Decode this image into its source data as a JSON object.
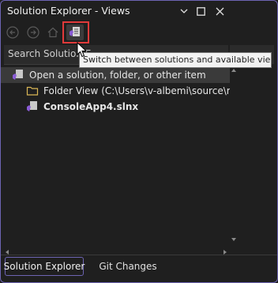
{
  "window": {
    "title": "Solution Explorer - Views",
    "controls": [
      "chevron-down-icon",
      "maximize-icon",
      "close-icon"
    ]
  },
  "toolbar": {
    "buttons": [
      "back-arrow-icon",
      "forward-arrow-icon",
      "home-icon",
      "switch-views-icon"
    ]
  },
  "search": {
    "text": "Search Solution E"
  },
  "tooltip": {
    "text": "Switch between solutions and available views"
  },
  "tree": {
    "items": [
      {
        "label": "Open a solution, folder, or other item",
        "icon": "solution-icon",
        "bold": false
      },
      {
        "label": "Folder View (C:\\Users\\v-albemi\\source\\repos",
        "icon": "folder-icon",
        "bold": false
      },
      {
        "label": "ConsoleApp4.slnx",
        "icon": "solution-file-icon",
        "bold": true
      }
    ]
  },
  "tabs": [
    {
      "label": "Solution Explorer",
      "active": true
    },
    {
      "label": "Git Changes",
      "active": false
    }
  ],
  "colors": {
    "accent": "#6d64b3",
    "highlight_border": "#e03a3a",
    "background": "#1f1f1f"
  }
}
